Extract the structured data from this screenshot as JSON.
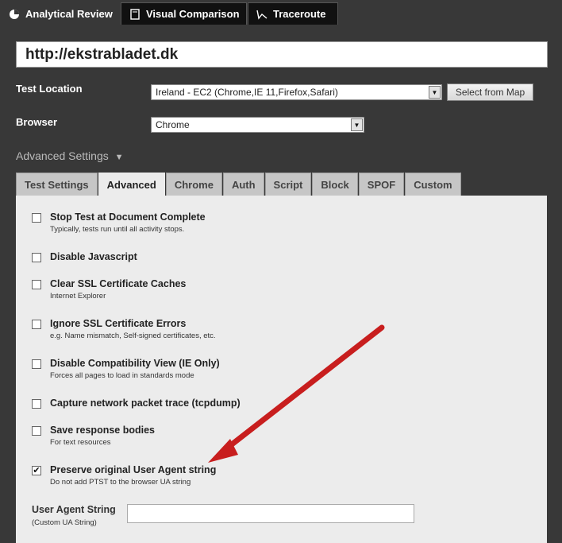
{
  "top_tabs": [
    {
      "label": "Analytical Review",
      "icon": "pie-chart-icon",
      "active": true
    },
    {
      "label": "Visual Comparison",
      "icon": "document-icon",
      "active": false
    },
    {
      "label": "Traceroute",
      "icon": "traceroute-icon",
      "active": false
    }
  ],
  "url": "http://ekstrabladet.dk",
  "test_location": {
    "label": "Test Location",
    "value": "Ireland - EC2 (Chrome,IE 11,Firefox,Safari)",
    "map_button": "Select from Map"
  },
  "browser": {
    "label": "Browser",
    "value": "Chrome"
  },
  "advanced": {
    "header": "Advanced Settings",
    "arrow": "▼"
  },
  "sub_tabs": [
    "Test Settings",
    "Advanced",
    "Chrome",
    "Auth",
    "Script",
    "Block",
    "SPOF",
    "Custom"
  ],
  "options": [
    {
      "title": "Stop Test at Document Complete",
      "desc": "Typically, tests run until all activity stops.",
      "checked": false
    },
    {
      "title": "Disable Javascript",
      "desc": "",
      "checked": false
    },
    {
      "title": "Clear SSL Certificate Caches",
      "desc": "Internet Explorer",
      "checked": false
    },
    {
      "title": "Ignore SSL Certificate Errors",
      "desc": "e.g. Name mismatch, Self-signed certificates, etc.",
      "checked": false
    },
    {
      "title": "Disable Compatibility View (IE Only)",
      "desc": "Forces all pages to load in standards mode",
      "checked": false
    },
    {
      "title": "Capture network packet trace (tcpdump)",
      "desc": "",
      "checked": false
    },
    {
      "title": "Save response bodies",
      "desc": "For text resources",
      "checked": false
    },
    {
      "title": "Preserve original User Agent string",
      "desc": "Do not add PTST to the browser UA string",
      "checked": true
    }
  ],
  "user_agent": {
    "label": "User Agent String",
    "sublabel": "(Custom UA String)",
    "value": ""
  },
  "colors": {
    "annotation_arrow": "#d42222",
    "page_bg": "#383838",
    "panel_bg": "#ececec"
  }
}
